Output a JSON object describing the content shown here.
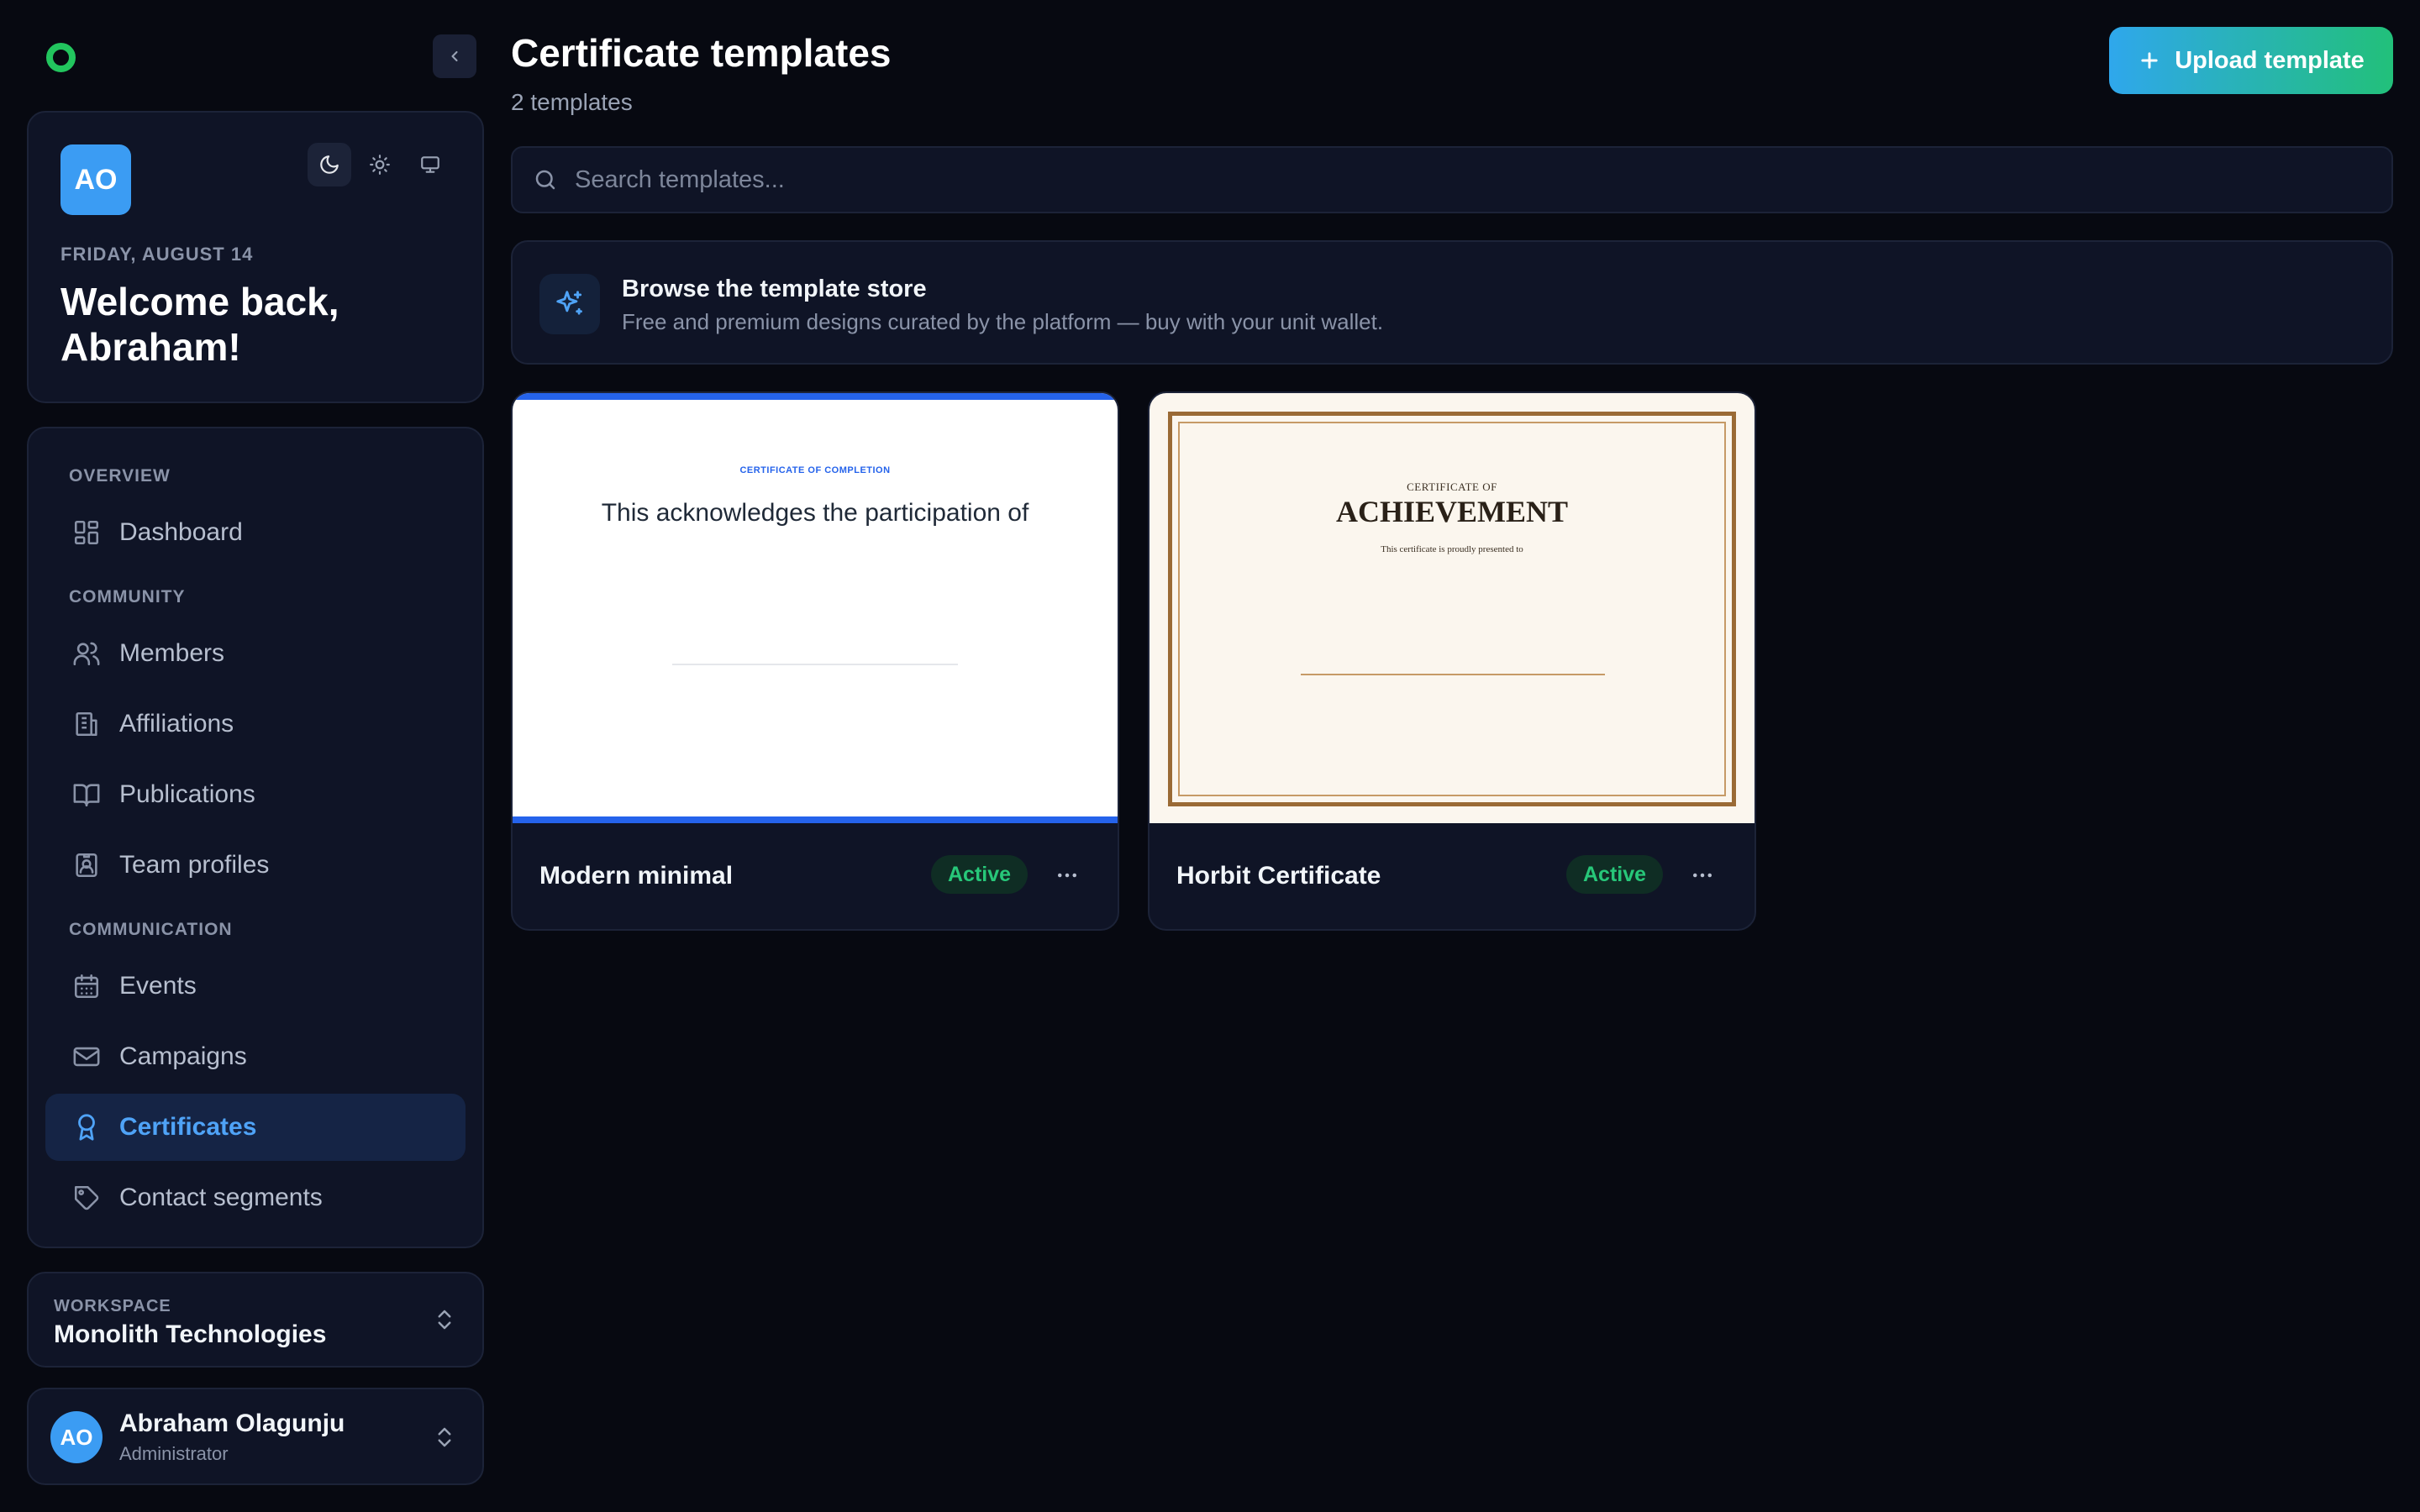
{
  "sidebar": {
    "profile": {
      "avatar_initials": "AO",
      "date": "FRIDAY, AUGUST 14",
      "welcome": "Welcome back, Abraham!",
      "theme_modes": [
        "moon-icon",
        "sun-icon",
        "monitor-icon"
      ],
      "active_theme": "dark"
    },
    "nav": {
      "sections": [
        {
          "label": "OVERVIEW"
        },
        {
          "label": "COMMUNITY"
        },
        {
          "label": "COMMUNICATION"
        }
      ],
      "items": [
        {
          "label": "Dashboard",
          "icon": "dashboard-icon"
        },
        {
          "label": "Members",
          "icon": "users-icon"
        },
        {
          "label": "Affiliations",
          "icon": "building-icon"
        },
        {
          "label": "Publications",
          "icon": "book-open-icon"
        },
        {
          "label": "Team profiles",
          "icon": "id-badge-icon"
        },
        {
          "label": "Events",
          "icon": "calendar-icon"
        },
        {
          "label": "Campaigns",
          "icon": "mail-icon"
        },
        {
          "label": "Certificates",
          "icon": "award-icon",
          "active": true
        },
        {
          "label": "Contact segments",
          "icon": "tag-icon"
        }
      ]
    },
    "workspace": {
      "label": "WORKSPACE",
      "name": "Monolith Technologies"
    },
    "user": {
      "initials": "AO",
      "name": "Abraham Olagunju",
      "role": "Administrator"
    }
  },
  "main": {
    "title": "Certificate templates",
    "subtitle": "2 templates",
    "upload_label": "Upload template",
    "search": {
      "placeholder": "Search templates...",
      "value": ""
    },
    "store_banner": {
      "title": "Browse the template store",
      "description": "Free and premium designs curated by the platform — buy with your unit wallet."
    },
    "templates": [
      {
        "name": "Modern minimal",
        "status": "Active",
        "preview": {
          "kicker": "CERTIFICATE OF COMPLETION",
          "text": "This acknowledges the participation of"
        }
      },
      {
        "name": "Horbit Certificate",
        "status": "Active",
        "preview": {
          "kicker": "CERTIFICATE OF",
          "title": "ACHIEVEMENT",
          "text": "This certificate is proudly presented to"
        }
      }
    ]
  },
  "colors": {
    "background": "#070911",
    "panel": "#0f1426",
    "accent": "#4fa3f7",
    "success": "#27c779",
    "brand_dot": "#22c55e"
  }
}
